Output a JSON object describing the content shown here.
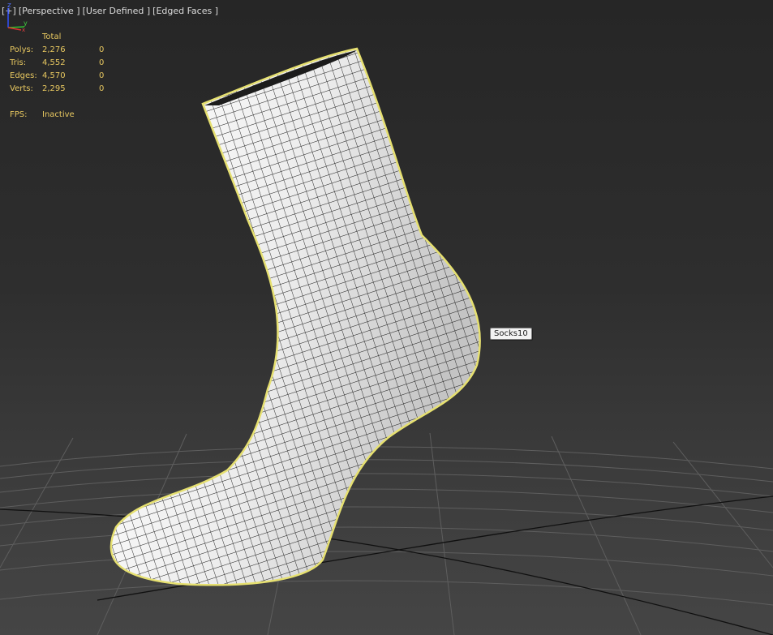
{
  "viewport_label": {
    "plus": "[+]",
    "view": "[Perspective ]",
    "mode": "[User Defined ]",
    "shading": "[Edged Faces ]"
  },
  "stats": {
    "header": "Total",
    "rows": [
      {
        "label": "Polys:",
        "total": "2,276",
        "selected": "0"
      },
      {
        "label": "Tris:",
        "total": "4,552",
        "selected": "0"
      },
      {
        "label": "Edges:",
        "total": "4,570",
        "selected": "0"
      },
      {
        "label": "Verts:",
        "total": "2,295",
        "selected": "0"
      }
    ],
    "fps_label": "FPS:",
    "fps_value": "Inactive"
  },
  "object_tooltip": "Socks10",
  "axis_gizmo": {
    "z": "z",
    "y": "y",
    "x": "x"
  },
  "colors": {
    "stats_text": "#e8c860",
    "selection_outline": "#e6e070",
    "mesh_fill": "#f2f2f2",
    "wire": "#1a1a1a"
  }
}
